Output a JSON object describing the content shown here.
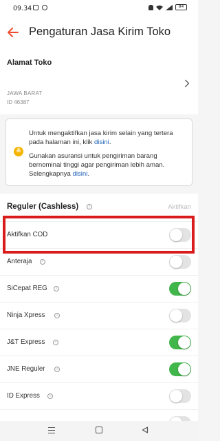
{
  "status_bar": {
    "time": "09.34",
    "battery": "84"
  },
  "appbar": {
    "title": "Pengaturan Jasa Kirim Toko"
  },
  "address": {
    "label": "Alamat Toko",
    "province": "JAWA BARAT",
    "postal": "ID 46387"
  },
  "info": {
    "p1_text": "Untuk mengaktifkan jasa kirim selain yang tertera pada halaman ini, klik ",
    "p1_link": "disini",
    "p1_end": ".",
    "p2_text": "Gunakan asuransi untuk pengiriman barang bernominal tinggi agar pengiriman lebih aman. Selengkapnya ",
    "p2_link": "disini",
    "p2_end": "."
  },
  "section": {
    "title": "Reguler (Cashless)",
    "action": "Aktifkan"
  },
  "couriers": [
    {
      "label": "Aktifkan COD",
      "info": false,
      "on": false
    },
    {
      "label": "Anteraja",
      "info": true,
      "on": false
    },
    {
      "label": "SiCepat REG",
      "info": true,
      "on": true
    },
    {
      "label": "Ninja Xpress",
      "info": true,
      "on": false
    },
    {
      "label": "J&T Express",
      "info": true,
      "on": true
    },
    {
      "label": "JNE Reguler",
      "info": true,
      "on": true
    },
    {
      "label": "ID Express",
      "info": true,
      "on": false
    }
  ],
  "colors": {
    "accent": "#ee4d2d",
    "toggle_on": "#41b64a",
    "link": "#1b5fb4",
    "highlight": "#d91b1b"
  },
  "icons": {
    "back": "arrow-left-icon",
    "chevron": "chevron-right-icon",
    "info": "info-icon",
    "warning": "insurance-icon"
  }
}
